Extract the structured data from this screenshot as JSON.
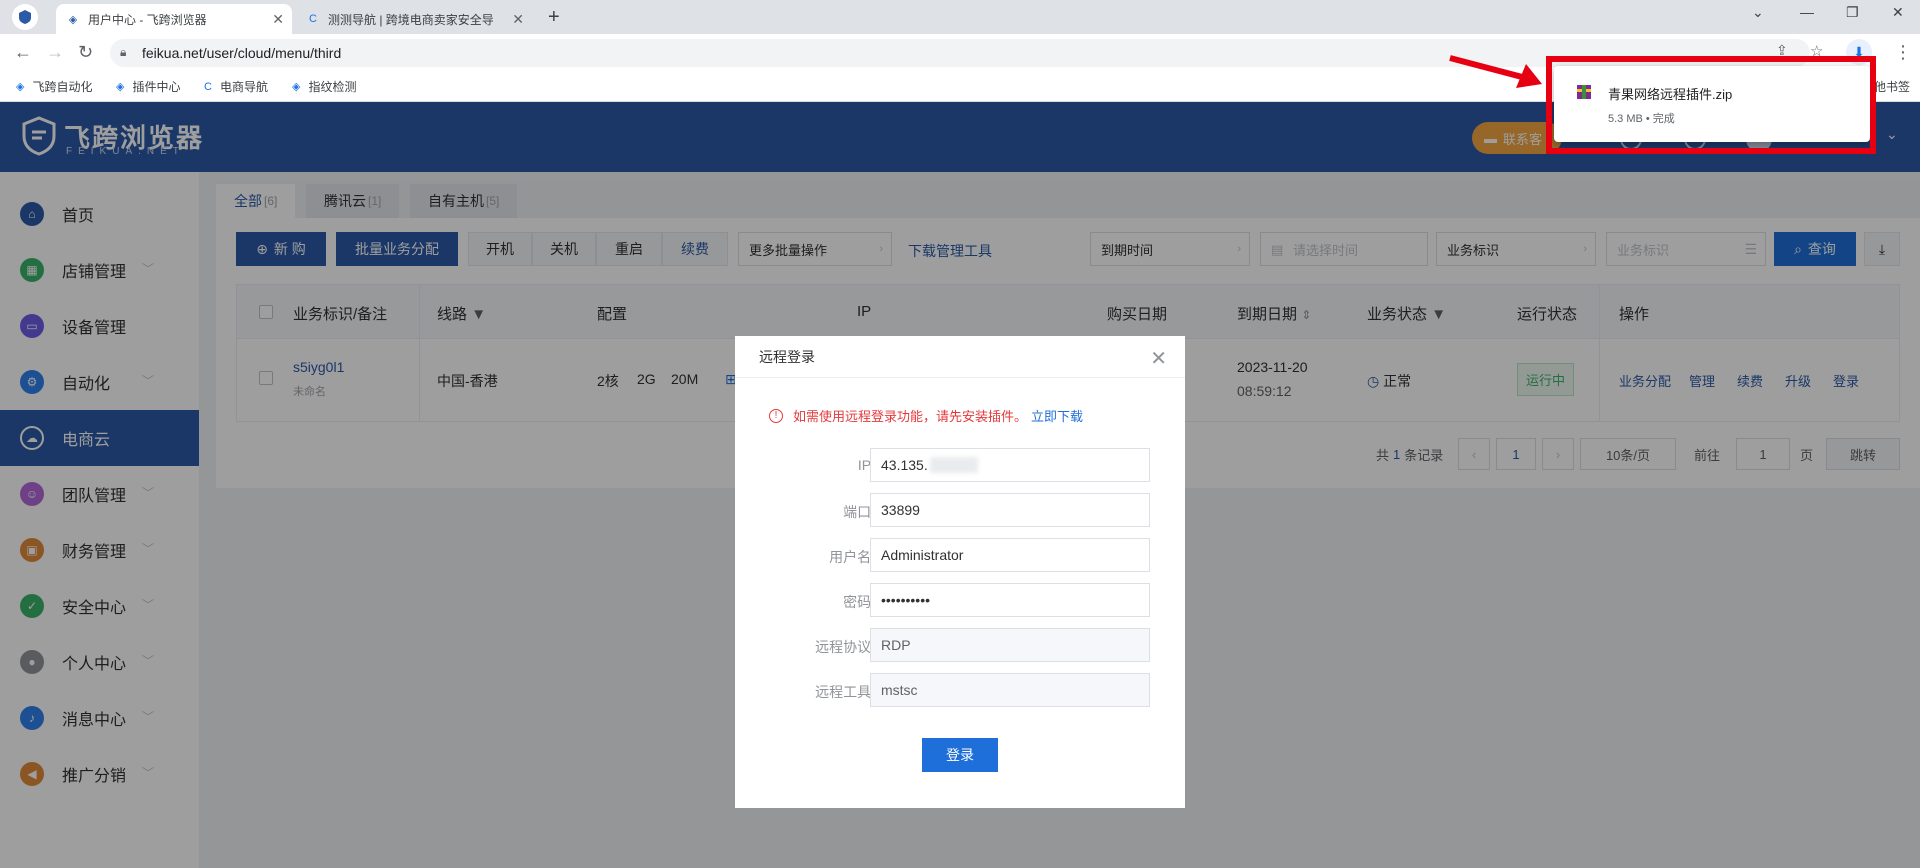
{
  "browser": {
    "tabs": [
      {
        "title": "用户中心 - 飞跨浏览器",
        "active": true
      },
      {
        "title": "测测导航 | 跨境电商卖家安全导",
        "active": false
      }
    ],
    "url": "feikua.net/user/cloud/menu/third",
    "bookmarks": [
      "飞跨自动化",
      "插件中心",
      "电商导航",
      "指纹检测"
    ],
    "bookmarks_more": "他书签"
  },
  "download": {
    "filename": "青果网络远程插件.zip",
    "meta": "5.3 MB • 完成"
  },
  "header": {
    "logo_title": "飞跨浏览器",
    "logo_sub": "FEIKUA.NET",
    "contact_label": "联系客"
  },
  "sidebar": {
    "items": [
      {
        "label": "首页",
        "icon": "home-icon",
        "color": "#2b5aa7",
        "expandable": false
      },
      {
        "label": "店铺管理",
        "icon": "store-icon",
        "color": "#3bb36b",
        "expandable": true
      },
      {
        "label": "设备管理",
        "icon": "device-icon",
        "color": "#6c5ce7",
        "expandable": false
      },
      {
        "label": "自动化",
        "icon": "robot-icon",
        "color": "#2f80ed",
        "expandable": true
      },
      {
        "label": "电商云",
        "icon": "cloud-icon",
        "color": "#2b5aa7",
        "expandable": false,
        "active": true
      },
      {
        "label": "团队管理",
        "icon": "team-icon",
        "color": "#b26ad8",
        "expandable": true
      },
      {
        "label": "财务管理",
        "icon": "wallet-icon",
        "color": "#e0893a",
        "expandable": true
      },
      {
        "label": "安全中心",
        "icon": "shield-icon",
        "color": "#3bb36b",
        "expandable": true
      },
      {
        "label": "个人中心",
        "icon": "user-icon",
        "color": "#909399",
        "expandable": true
      },
      {
        "label": "消息中心",
        "icon": "bell-icon",
        "color": "#2f80ed",
        "expandable": true
      },
      {
        "label": "推广分销",
        "icon": "megaphone-icon",
        "color": "#e0893a",
        "expandable": true
      }
    ]
  },
  "content": {
    "tabs": [
      {
        "label": "全部",
        "count": "[6]"
      },
      {
        "label": "腾讯云",
        "count": "[1]"
      },
      {
        "label": "自有主机",
        "count": "[5]"
      }
    ],
    "toolbar": {
      "new_label": "新 购",
      "batch_assign_label": "批量业务分配",
      "power_on": "开机",
      "power_off": "关机",
      "restart": "重启",
      "renew": "续费",
      "more_batch": "更多批量操作",
      "download_tool": "下载管理工具",
      "expire_select": "到期时间",
      "date_placeholder": "请选择时间",
      "biz_select": "业务标识",
      "biz_placeholder": "业务标识",
      "query_label": "查询"
    },
    "table": {
      "headers": [
        "业务标识/备注",
        "线路",
        "配置",
        "IP",
        "购买日期",
        "到期日期",
        "业务状态",
        "运行状态",
        "操作"
      ],
      "row": {
        "id": "s5iyg0l1",
        "note": "未命名",
        "line": "中国-香港",
        "cpu": "2核",
        "ram": "2G",
        "bw": "20M",
        "expire_date": "2023-11-20",
        "expire_time": "08:59:12",
        "biz_status": "正常",
        "run_status": "运行中",
        "actions": [
          "业务分配",
          "管理",
          "续费",
          "升级",
          "登录"
        ]
      }
    },
    "pager": {
      "total_prefix": "共",
      "total": "1",
      "total_suffix": "条记录",
      "page": "1",
      "page_size": "10条/页",
      "goto_label": "前往",
      "goto_value": "1",
      "page_unit": "页",
      "jump_label": "跳转"
    }
  },
  "modal": {
    "title": "远程登录",
    "warning": "如需使用远程登录功能，请先安装插件。",
    "warning_link": "立即下载",
    "fields": [
      {
        "label": "IP:",
        "value": "43.135."
      },
      {
        "label": "端口:",
        "value": "33899"
      },
      {
        "label": "用户名:",
        "value": "Administrator"
      },
      {
        "label": "密码:",
        "value": "••••••••••"
      },
      {
        "label": "远程协议:",
        "value": "RDP"
      },
      {
        "label": "远程工具:",
        "value": "mstsc"
      }
    ],
    "submit_label": "登录"
  },
  "colors": {
    "brand": "#2b5aa7",
    "primary_button": "#1e6fd9",
    "highlight": "#e60012",
    "success": "#3bb36b"
  }
}
